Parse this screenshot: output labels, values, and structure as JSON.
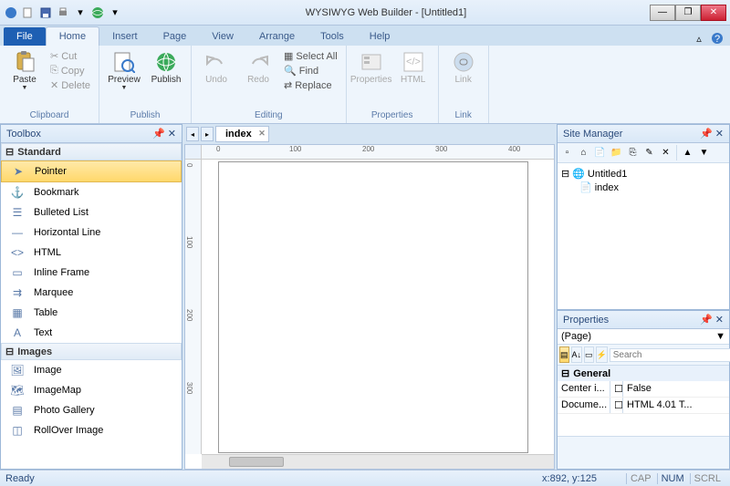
{
  "title": "WYSIWYG Web Builder - [Untitled1]",
  "menu": {
    "file": "File"
  },
  "tabs": [
    "Home",
    "Insert",
    "Page",
    "View",
    "Arrange",
    "Tools",
    "Help"
  ],
  "active_tab": 0,
  "ribbon": {
    "clipboard": {
      "label": "Clipboard",
      "paste": "Paste",
      "cut": "Cut",
      "copy": "Copy",
      "delete": "Delete"
    },
    "publish": {
      "label": "Publish",
      "preview": "Preview",
      "publish_btn": "Publish"
    },
    "editing": {
      "label": "Editing",
      "undo": "Undo",
      "redo": "Redo",
      "select_all": "Select All",
      "find": "Find",
      "replace": "Replace"
    },
    "properties": {
      "label": "Properties",
      "properties_btn": "Properties",
      "html": "HTML"
    },
    "link": {
      "label": "Link",
      "link_btn": "Link"
    }
  },
  "toolbox": {
    "title": "Toolbox",
    "categories": [
      {
        "name": "Standard",
        "items": [
          "Pointer",
          "Bookmark",
          "Bulleted List",
          "Horizontal Line",
          "HTML",
          "Inline Frame",
          "Marquee",
          "Table",
          "Text"
        ],
        "selected": 0
      },
      {
        "name": "Images",
        "items": [
          "Image",
          "ImageMap",
          "Photo Gallery",
          "RollOver Image"
        ]
      }
    ]
  },
  "document": {
    "tab": "index",
    "ruler_marks": [
      "0",
      "100",
      "200",
      "300",
      "400"
    ]
  },
  "site_manager": {
    "title": "Site Manager",
    "root": "Untitled1",
    "children": [
      "index"
    ]
  },
  "properties": {
    "title": "Properties",
    "selector": "(Page)",
    "search_placeholder": "Search",
    "category": "General",
    "rows": [
      {
        "name": "Center i...",
        "value": "False"
      },
      {
        "name": "Docume...",
        "value": "HTML 4.01 T..."
      }
    ]
  },
  "status": {
    "ready": "Ready",
    "coords": "x:892, y:125",
    "cap": "CAP",
    "num": "NUM",
    "scrl": "SCRL"
  }
}
